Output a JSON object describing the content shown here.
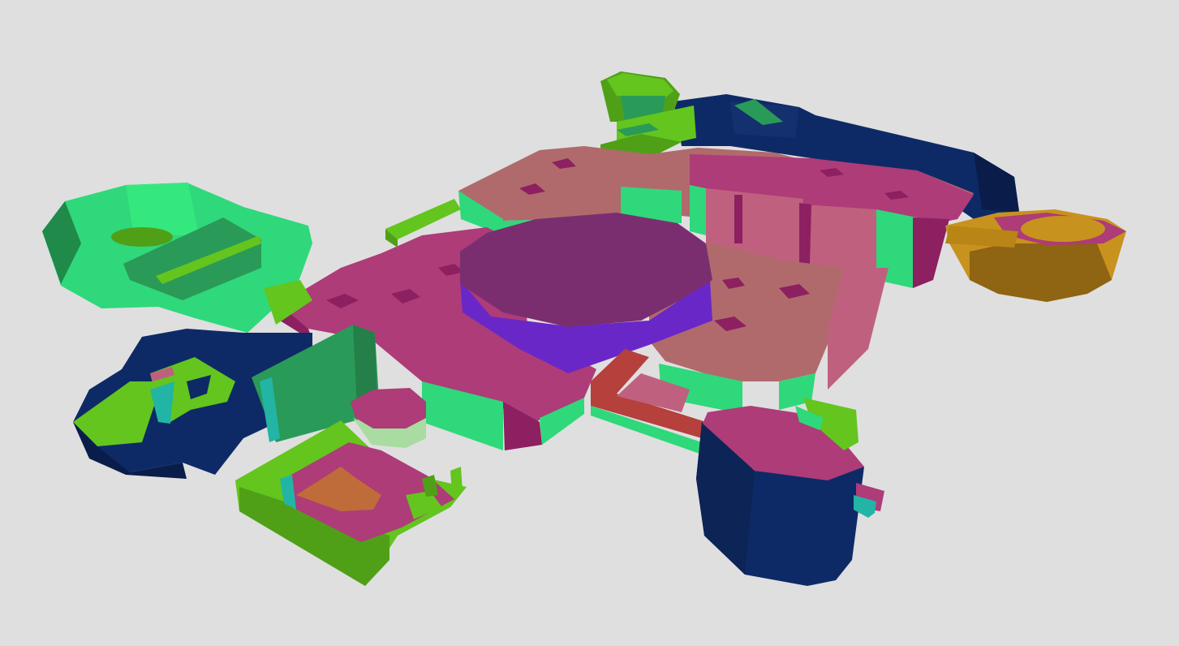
{
  "viewport": {
    "background": "#dfdfdf",
    "render_style": "flat-shaded 3D level geometry, isometric perspective"
  },
  "palette": {
    "magenta": "#ad3c78",
    "magenta_dark": "#8c2061",
    "rose": "#b06a6c",
    "rose_side": "#c0607f",
    "purple_top": "#7b2e6f",
    "purple_side": "#6a27c8",
    "green": "#2fd87a",
    "green_dark": "#2a9a58",
    "lime": "#63c51e",
    "lime_dark": "#4fa017",
    "navy": "#0e2a66",
    "navy_dark": "#0a1d4a",
    "gold": "#c8921e",
    "gold_dark": "#8f6412",
    "teal": "#22b5a6",
    "red": "#b5403c",
    "orange": "#c06b3a",
    "pale_green": "#a8dca0"
  }
}
